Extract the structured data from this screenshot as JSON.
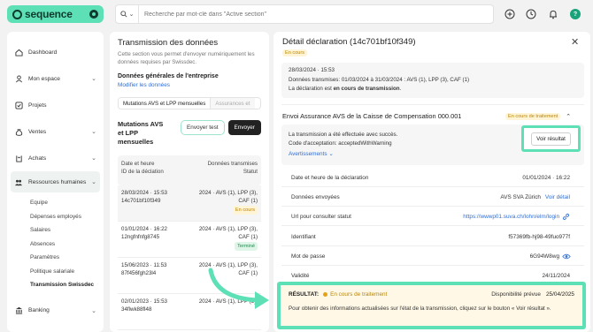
{
  "logo": {
    "text": "sequence"
  },
  "search": {
    "scope_icon": "search-icon",
    "placeholder": "Recherche par mot-clé dans \"Active section\""
  },
  "sidebar": {
    "items": [
      {
        "label": "Dashboard",
        "icon": "home-icon"
      },
      {
        "label": "Mon espace",
        "icon": "user-icon"
      },
      {
        "label": "Projets",
        "icon": "check-square-icon"
      },
      {
        "label": "Ventes",
        "icon": "money-bag-icon"
      },
      {
        "label": "Achats",
        "icon": "cart-icon"
      },
      {
        "label": "Ressources humaines",
        "icon": "people-icon"
      }
    ],
    "sub_items": [
      "Equipe",
      "Dépenses employés",
      "Salaires",
      "Absences",
      "Paramètres",
      "Politique salariale",
      "Transmission Swissdec"
    ],
    "bottom_items": [
      {
        "label": "Banking",
        "icon": "bank-icon"
      }
    ]
  },
  "middle": {
    "title": "Transmission des données",
    "description": "Cette section vous permet d'envoyer numériquement les données requises par Swissdec.",
    "company_heading": "Données générales de l'entreprise",
    "company_link": "Modifier les données",
    "tabs": [
      "Mutations AVS et LPP mensuelles",
      "Assurances et"
    ],
    "mutations_title": [
      "Mutations AVS",
      "et LPP",
      "mensuelles"
    ],
    "btn_test": "Envoyer test",
    "btn_send": "Envoyer",
    "head_left": [
      "Date et heure",
      "ID de la déclation"
    ],
    "head_right": [
      "Données transmises",
      "Statut"
    ],
    "rows": [
      {
        "date": "28/03/2024 · 15:53",
        "id": "14c701bf10f349",
        "data": [
          "2024 · AVS (1), LPP (3),",
          "CAF (1)"
        ],
        "status": "En cours",
        "status_type": "pending"
      },
      {
        "date": "01/01/2024 · 16:22",
        "id": "12ngfnfnfg8745",
        "data": [
          "2024 · AVS (1), LPP (3),",
          "CAF (1)"
        ],
        "status": "Terminé",
        "status_type": "done"
      },
      {
        "date": "15/06/2023 · 11:53",
        "id": "87f456fgh23l4",
        "data": [
          "2024 · AVS (1), LPP (3),",
          "CAF (1)"
        ],
        "status": "",
        "status_type": ""
      },
      {
        "date": "02/01/2023 · 15:53",
        "id": "34flwk88fl48",
        "data": [
          "2024 · AVS (1), LPP (3),",
          ""
        ],
        "status": "",
        "status_type": ""
      }
    ]
  },
  "detail": {
    "title": "Détail déclaration (14c701bf10f349)",
    "status": "En cours",
    "datetime": "28/03/2024 · 15:53",
    "transmitted": "Données transmises: 01/03/2024 à 31/03/2024 : AVS (1), LPP (3), CAF (1)",
    "state_prefix": "La déclaration est ",
    "state_bold": "en cours de transmission",
    "state_suffix": ".",
    "section_title": "Envoi Assurance AVS de la Caisse de Compensation 000.001",
    "section_status": "En cours de traitement",
    "success_line1": "La transmission a été effectuée avec succès.",
    "success_line2": "Code d'acceptation: acceptedWithWarning",
    "warnings_link": "Avertissements",
    "voir_button": "Voir résultat",
    "fields": [
      {
        "label": "Date et heure de la déclaration",
        "value": "01/01/2024 · 16:22"
      },
      {
        "label": "Données envoyées",
        "value": "AVS SVA Zürich",
        "link": "Voir détail"
      },
      {
        "label": "Url pour consulter statut",
        "value": "https://wwwp01.suva.ch/lohn/elm/login",
        "icon": "link-icon"
      },
      {
        "label": "Identifiant",
        "value": "f57369fb-hj98-49fuo977f"
      },
      {
        "label": "Mot de passe",
        "value": "6G94W8wg",
        "icon": "eye-icon"
      },
      {
        "label": "Validité",
        "value": "24/11/2024"
      }
    ],
    "result": {
      "label": "RÉSULTAT:",
      "status": "En cours de traitement",
      "availability_label": "Disponibilité prévue",
      "availability_date": "25/04/2025",
      "text": "Pour obtenir des informations actualisées sur l'état de la transmission, cliquez sur le bouton « Voir résultat »."
    }
  },
  "colors": {
    "accent": "#5ee0b6",
    "link": "#2f6fd6",
    "pending": "#b8860b",
    "done": "#1f8c4e"
  }
}
